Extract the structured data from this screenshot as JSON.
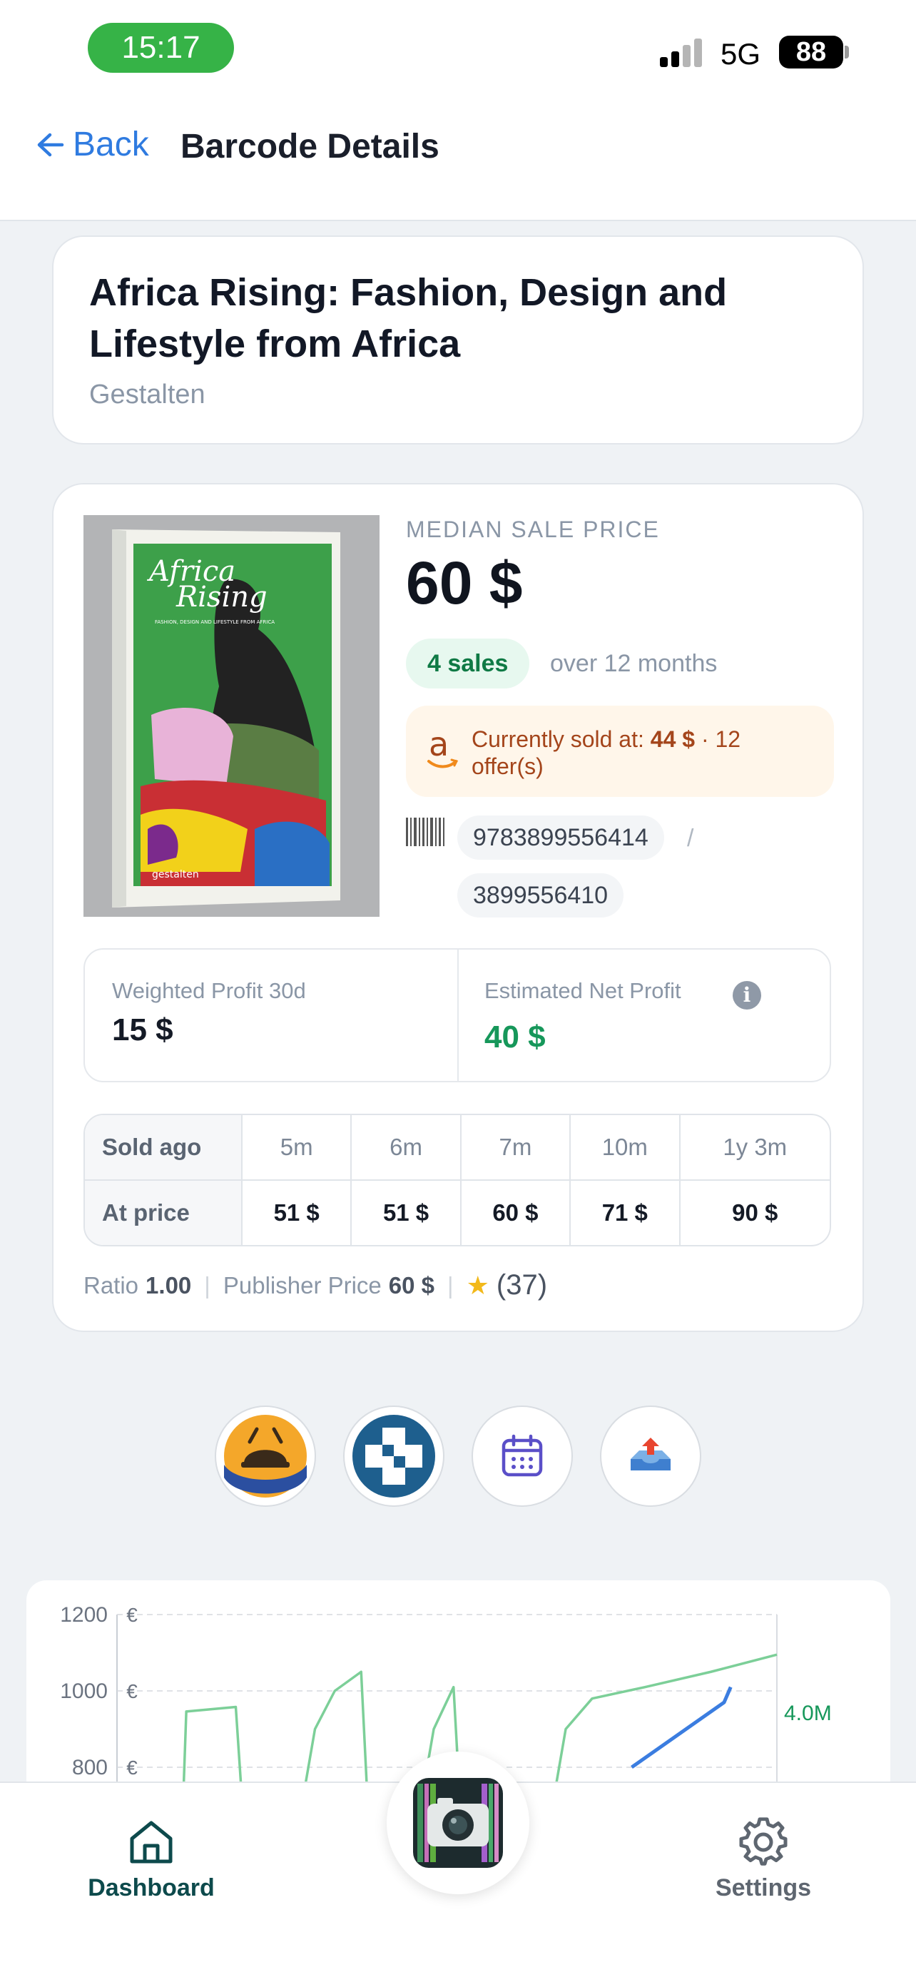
{
  "status_bar": {
    "time": "15:17",
    "network": "5G",
    "battery": "88"
  },
  "header": {
    "back_label": "Back",
    "title": "Barcode Details"
  },
  "book": {
    "title": "Africa Rising: Fashion, Design and Lifestyle from Africa",
    "publisher": "Gestalten",
    "cover": {
      "title_line1": "Africa",
      "title_line2": "Rising",
      "subtitle": "FASHION, DESIGN AND LIFESTYLE FROM AFRICA",
      "imprint": "gestalten"
    }
  },
  "pricing": {
    "median_label": "MEDIAN SALE PRICE",
    "median_value": "60 $",
    "sales_count": "4 sales",
    "sales_period": "over 12 months",
    "amazon_prefix": "Currently sold at:",
    "amazon_price": "44 $",
    "amazon_offers": "· 12 offer(s)",
    "ean": "9783899556414",
    "separator": "/",
    "isbn10": "3899556410"
  },
  "profit": {
    "weighted_label": "Weighted Profit 30d",
    "weighted_value": "15 $",
    "net_label": "Estimated Net Profit",
    "net_value": "40 $",
    "info_glyph": "i"
  },
  "sold_history": {
    "row1_label": "Sold ago",
    "row2_label": "At price",
    "ages": [
      "5m",
      "6m",
      "7m",
      "10m",
      "1y 3m"
    ],
    "prices": [
      "51 $",
      "51 $",
      "60 $",
      "71 $",
      "90 $"
    ]
  },
  "stats": {
    "ratio_label": "Ratio",
    "ratio_value": "1.00",
    "publisher_price_label": "Publisher Price",
    "publisher_price_value": "60 $",
    "rating_count": "(37)"
  },
  "actions": [
    {
      "icon": "marketplace-logo-icon"
    },
    {
      "icon": "medical-cross-logo-icon"
    },
    {
      "icon": "calendar-icon"
    },
    {
      "icon": "upload-tray-icon"
    }
  ],
  "chart_data": {
    "type": "line",
    "y_ticks": [
      "1200",
      "1000",
      "800"
    ],
    "y_unit": "€",
    "right_label": "4.0M",
    "ylim": [
      800,
      1200
    ],
    "grid": true,
    "series": [
      {
        "color": "#7ccf98",
        "segments": [
          [
            [
              0.1,
              700
            ],
            [
              0.105,
              946
            ],
            [
              0.18,
              958
            ],
            [
              0.19,
              700
            ]
          ],
          [
            [
              0.28,
              700
            ],
            [
              0.3,
              900
            ],
            [
              0.33,
              1000
            ],
            [
              0.37,
              1050
            ],
            [
              0.38,
              700
            ]
          ],
          [
            [
              0.46,
              700
            ],
            [
              0.48,
              900
            ],
            [
              0.51,
              1010
            ],
            [
              0.52,
              700
            ]
          ],
          [
            [
              0.66,
              700
            ],
            [
              0.68,
              900
            ],
            [
              0.72,
              980
            ],
            [
              0.8,
              1010
            ],
            [
              0.9,
              1050
            ],
            [
              1.0,
              1095
            ]
          ]
        ]
      },
      {
        "color": "#3b7de0",
        "segments": [
          [
            [
              0.78,
              800
            ],
            [
              0.92,
              970
            ],
            [
              0.93,
              1010
            ]
          ]
        ]
      }
    ]
  },
  "tabbar": {
    "dashboard_label": "Dashboard",
    "settings_label": "Settings"
  },
  "colors": {
    "accent": "#2f7be0",
    "profit_green": "#16975a",
    "amazon": "#a4451b",
    "nav_active": "#0d4a4c"
  }
}
